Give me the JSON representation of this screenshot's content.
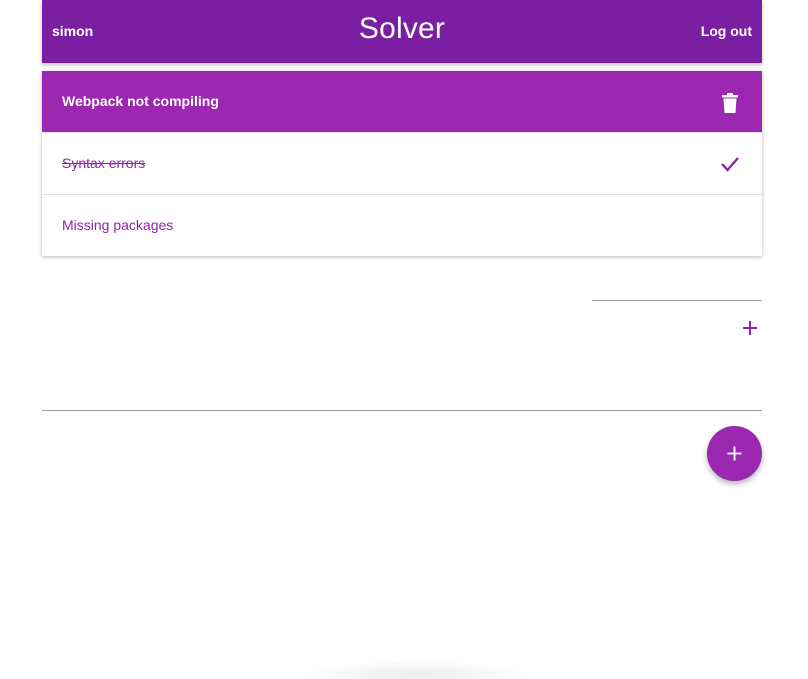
{
  "header": {
    "username": "simon",
    "title": "Solver",
    "logout_label": "Log out"
  },
  "card": {
    "title": "Webpack not compiling",
    "tasks": [
      {
        "label": "Syntax errors",
        "done": true
      },
      {
        "label": "Missing packages",
        "done": false
      }
    ]
  },
  "add_task": {
    "placeholder": ""
  },
  "new_card": {
    "placeholder": ""
  },
  "colors": {
    "header": "#7b1fa2",
    "card_header": "#9c27b0",
    "accent": "#8e24aa"
  },
  "icons": {
    "delete": "trash-icon",
    "done": "check-icon",
    "add_task": "plus-icon",
    "add_card": "plus-icon"
  }
}
